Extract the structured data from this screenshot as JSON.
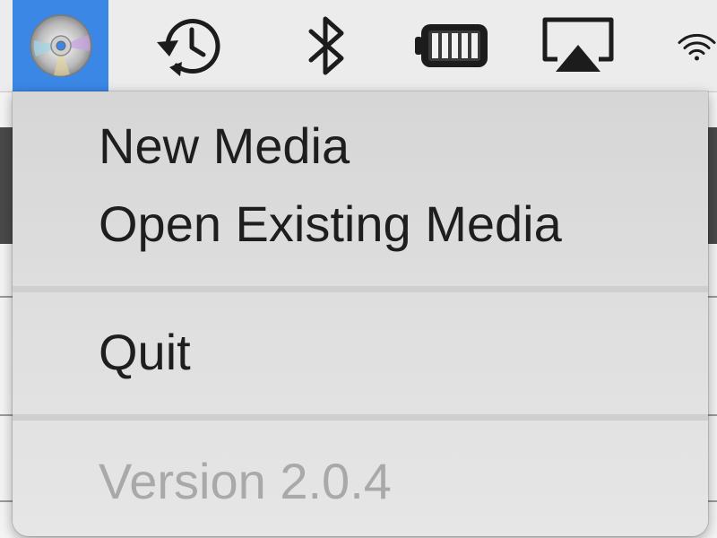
{
  "menubar": {
    "app_icon": "dvd-disc-icon",
    "time_machine_icon": "time-machine-icon",
    "bluetooth_icon": "bluetooth-icon",
    "battery_icon": "battery-icon",
    "airplay_icon": "airplay-icon",
    "wifi_icon": "wifi-icon",
    "selected_color": "#3a87e6"
  },
  "menu": {
    "items": [
      {
        "label": "New Media",
        "enabled": true
      },
      {
        "label": "Open Existing Media",
        "enabled": true
      },
      {
        "label": "Quit",
        "enabled": true
      },
      {
        "label": "Version 2.0.4",
        "enabled": false
      }
    ]
  }
}
